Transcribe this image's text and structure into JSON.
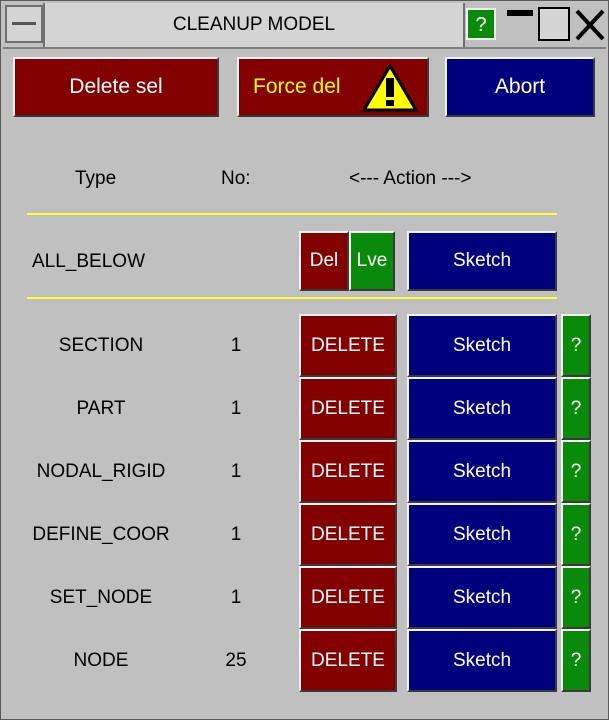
{
  "window": {
    "title": "CLEANUP MODEL",
    "help_label": "?"
  },
  "toolbar": {
    "delete_sel_label": "Delete sel",
    "force_del_label": "Force del",
    "abort_label": "Abort"
  },
  "header": {
    "type_label": "Type",
    "no_label": "No:",
    "action_label": "<--- Action --->"
  },
  "all_below": {
    "label": "ALL_BELOW",
    "del_label": "Del",
    "lve_label": "Lve",
    "sketch_label": "Sketch"
  },
  "rows": [
    {
      "type": "SECTION",
      "no": "1",
      "delete": "DELETE",
      "sketch": "Sketch",
      "help": "?"
    },
    {
      "type": "PART",
      "no": "1",
      "delete": "DELETE",
      "sketch": "Sketch",
      "help": "?"
    },
    {
      "type": "NODAL_RIGID",
      "no": "1",
      "delete": "DELETE",
      "sketch": "Sketch",
      "help": "?"
    },
    {
      "type": "DEFINE_COOR",
      "no": "1",
      "delete": "DELETE",
      "sketch": "Sketch",
      "help": "?"
    },
    {
      "type": "SET_NODE",
      "no": "1",
      "delete": "DELETE",
      "sketch": "Sketch",
      "help": "?"
    },
    {
      "type": "NODE",
      "no": "25",
      "delete": "DELETE",
      "sketch": "Sketch",
      "help": "?"
    }
  ],
  "colors": {
    "background": "#c0c0c0",
    "delete_red": "#820000",
    "action_blue": "#00007f",
    "help_green": "#0a8a0a",
    "separator_yellow": "#ffff3c",
    "warning_yellow": "#ffff00"
  },
  "icons": {
    "warning": "warning-triangle-icon",
    "menu": "window-menu-icon",
    "minimize": "minimize-icon",
    "maximize": "maximize-icon",
    "close": "close-icon"
  }
}
